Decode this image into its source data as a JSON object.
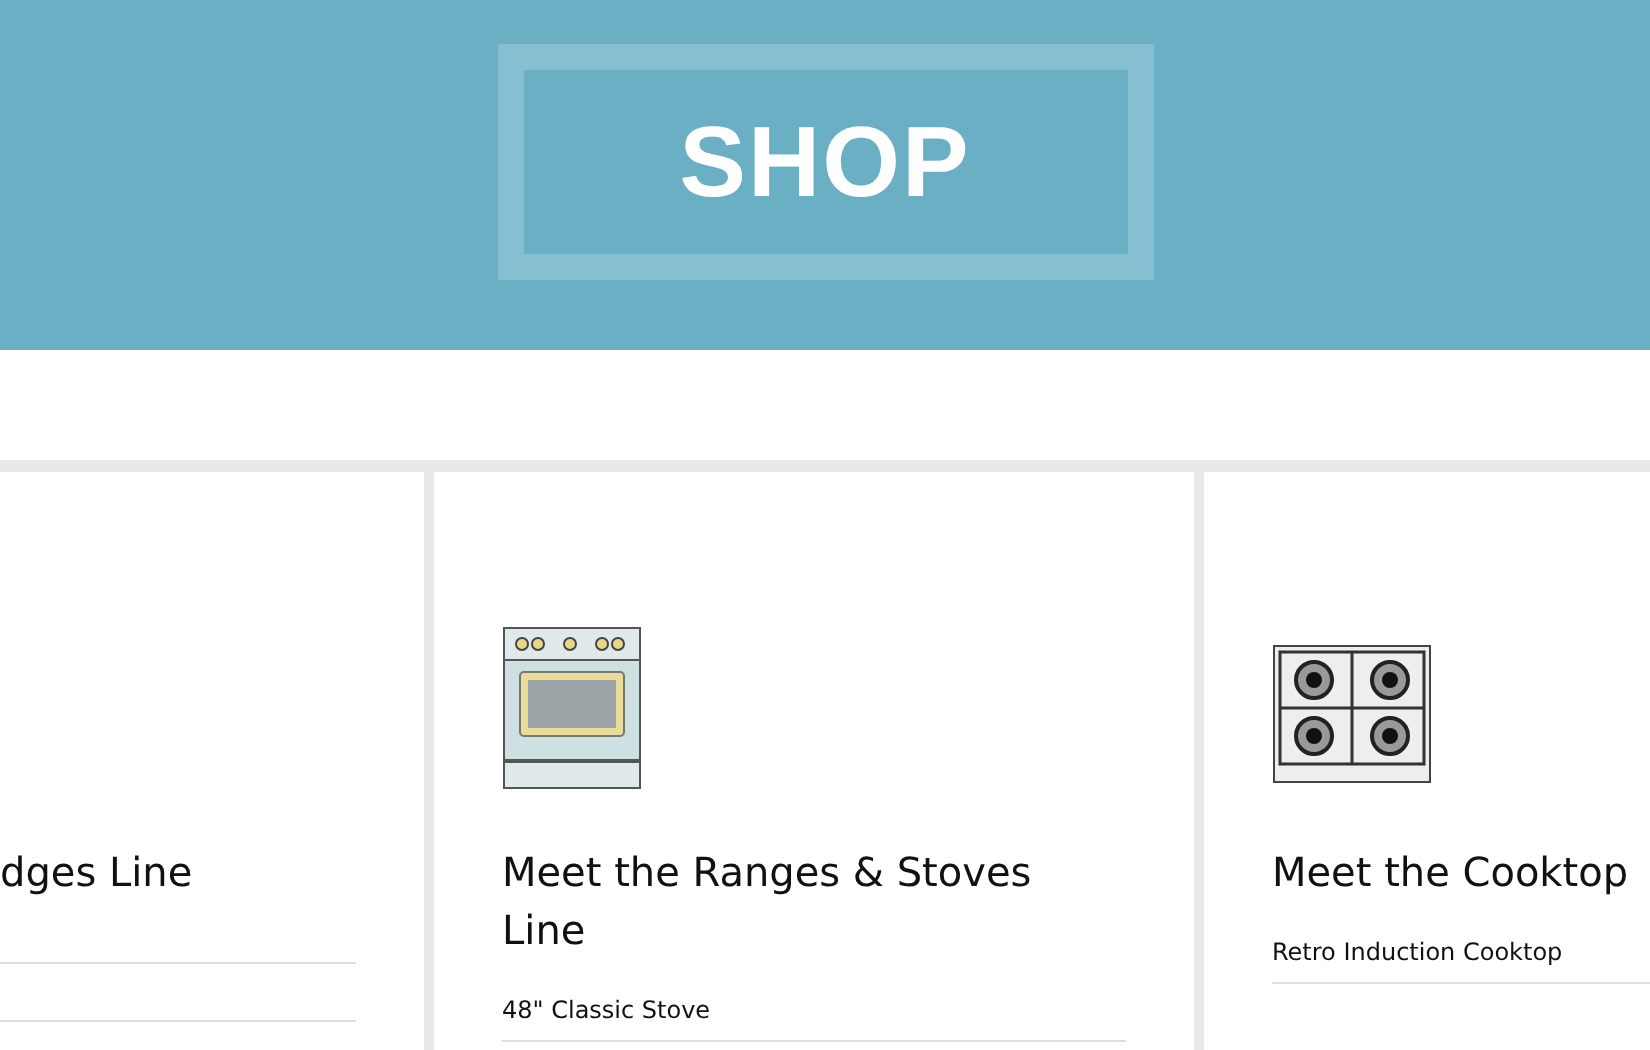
{
  "header": {
    "title": "SHOP"
  },
  "cards": [
    {
      "kind": "partial",
      "title": "dges Line"
    },
    {
      "kind": "range",
      "title": "Meet the Ranges & Stoves Line",
      "items": [
        "48\" Classic Stove"
      ]
    },
    {
      "kind": "cooktop",
      "title": "Meet the Cooktop",
      "items": [
        "Retro Induction Cooktop"
      ]
    }
  ]
}
